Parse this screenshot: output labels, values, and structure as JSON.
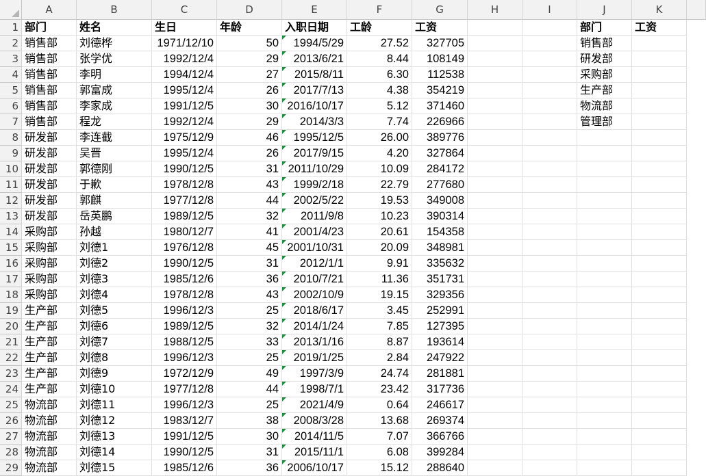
{
  "columns": [
    "A",
    "B",
    "C",
    "D",
    "E",
    "F",
    "G",
    "H",
    "I",
    "J",
    "K"
  ],
  "header_row": [
    "部门",
    "姓名",
    "生日",
    "年龄",
    "入职日期",
    "工龄",
    "工资"
  ],
  "side_table": {
    "header": [
      "部门",
      "工资"
    ],
    "departments": [
      "销售部",
      "研发部",
      "采购部",
      "生产部",
      "物流部",
      "管理部"
    ]
  },
  "rows": [
    [
      "销售部",
      "刘德桦",
      "1971/12/10",
      "50",
      "1994/5/29",
      "27.52",
      "327705"
    ],
    [
      "销售部",
      "张学优",
      "1992/12/4",
      "29",
      "2013/6/21",
      "8.44",
      "108149"
    ],
    [
      "销售部",
      "李明",
      "1994/12/4",
      "27",
      "2015/8/11",
      "6.30",
      "112538"
    ],
    [
      "销售部",
      "郭富成",
      "1995/12/4",
      "26",
      "2017/7/13",
      "4.38",
      "354219"
    ],
    [
      "销售部",
      "李家成",
      "1991/12/5",
      "30",
      "2016/10/17",
      "5.12",
      "371460"
    ],
    [
      "销售部",
      "程龙",
      "1992/12/4",
      "29",
      "2014/3/3",
      "7.74",
      "226966"
    ],
    [
      "研发部",
      "李连截",
      "1975/12/9",
      "46",
      "1995/12/5",
      "26.00",
      "389776"
    ],
    [
      "研发部",
      "吴晋",
      "1995/12/4",
      "26",
      "2017/9/15",
      "4.20",
      "327864"
    ],
    [
      "研发部",
      "郭德刚",
      "1990/12/5",
      "31",
      "2011/10/29",
      "10.09",
      "284172"
    ],
    [
      "研发部",
      "于歉",
      "1978/12/8",
      "43",
      "1999/2/18",
      "22.79",
      "277680"
    ],
    [
      "研发部",
      "郭麒",
      "1977/12/8",
      "44",
      "2002/5/22",
      "19.53",
      "349008"
    ],
    [
      "研发部",
      "岳英鹏",
      "1989/12/5",
      "32",
      "2011/9/8",
      "10.23",
      "390314"
    ],
    [
      "采购部",
      "孙越",
      "1980/12/7",
      "41",
      "2001/4/23",
      "20.61",
      "154358"
    ],
    [
      "采购部",
      "刘德1",
      "1976/12/8",
      "45",
      "2001/10/31",
      "20.09",
      "348981"
    ],
    [
      "采购部",
      "刘德2",
      "1990/12/5",
      "31",
      "2012/1/1",
      "9.91",
      "335632"
    ],
    [
      "采购部",
      "刘德3",
      "1985/12/6",
      "36",
      "2010/7/21",
      "11.36",
      "351731"
    ],
    [
      "采购部",
      "刘德4",
      "1978/12/8",
      "43",
      "2002/10/9",
      "19.15",
      "329356"
    ],
    [
      "生产部",
      "刘德5",
      "1996/12/3",
      "25",
      "2018/6/17",
      "3.45",
      "252991"
    ],
    [
      "生产部",
      "刘德6",
      "1989/12/5",
      "32",
      "2014/1/24",
      "7.85",
      "127395"
    ],
    [
      "生产部",
      "刘德7",
      "1988/12/5",
      "33",
      "2013/1/16",
      "8.87",
      "193614"
    ],
    [
      "生产部",
      "刘德8",
      "1996/12/3",
      "25",
      "2019/1/25",
      "2.84",
      "247922"
    ],
    [
      "生产部",
      "刘德9",
      "1972/12/9",
      "49",
      "1997/3/9",
      "24.74",
      "281881"
    ],
    [
      "生产部",
      "刘德10",
      "1977/12/8",
      "44",
      "1998/7/1",
      "23.42",
      "317736"
    ],
    [
      "物流部",
      "刘德11",
      "1996/12/3",
      "25",
      "2021/4/9",
      "0.64",
      "246617"
    ],
    [
      "物流部",
      "刘德12",
      "1983/12/7",
      "38",
      "2008/3/28",
      "13.68",
      "269374"
    ],
    [
      "物流部",
      "刘德13",
      "1991/12/5",
      "30",
      "2014/11/5",
      "7.07",
      "366766"
    ],
    [
      "物流部",
      "刘德14",
      "1990/12/5",
      "31",
      "2015/11/1",
      "6.08",
      "399284"
    ],
    [
      "物流部",
      "刘德15",
      "1985/12/6",
      "36",
      "2006/10/17",
      "15.12",
      "288640"
    ]
  ]
}
